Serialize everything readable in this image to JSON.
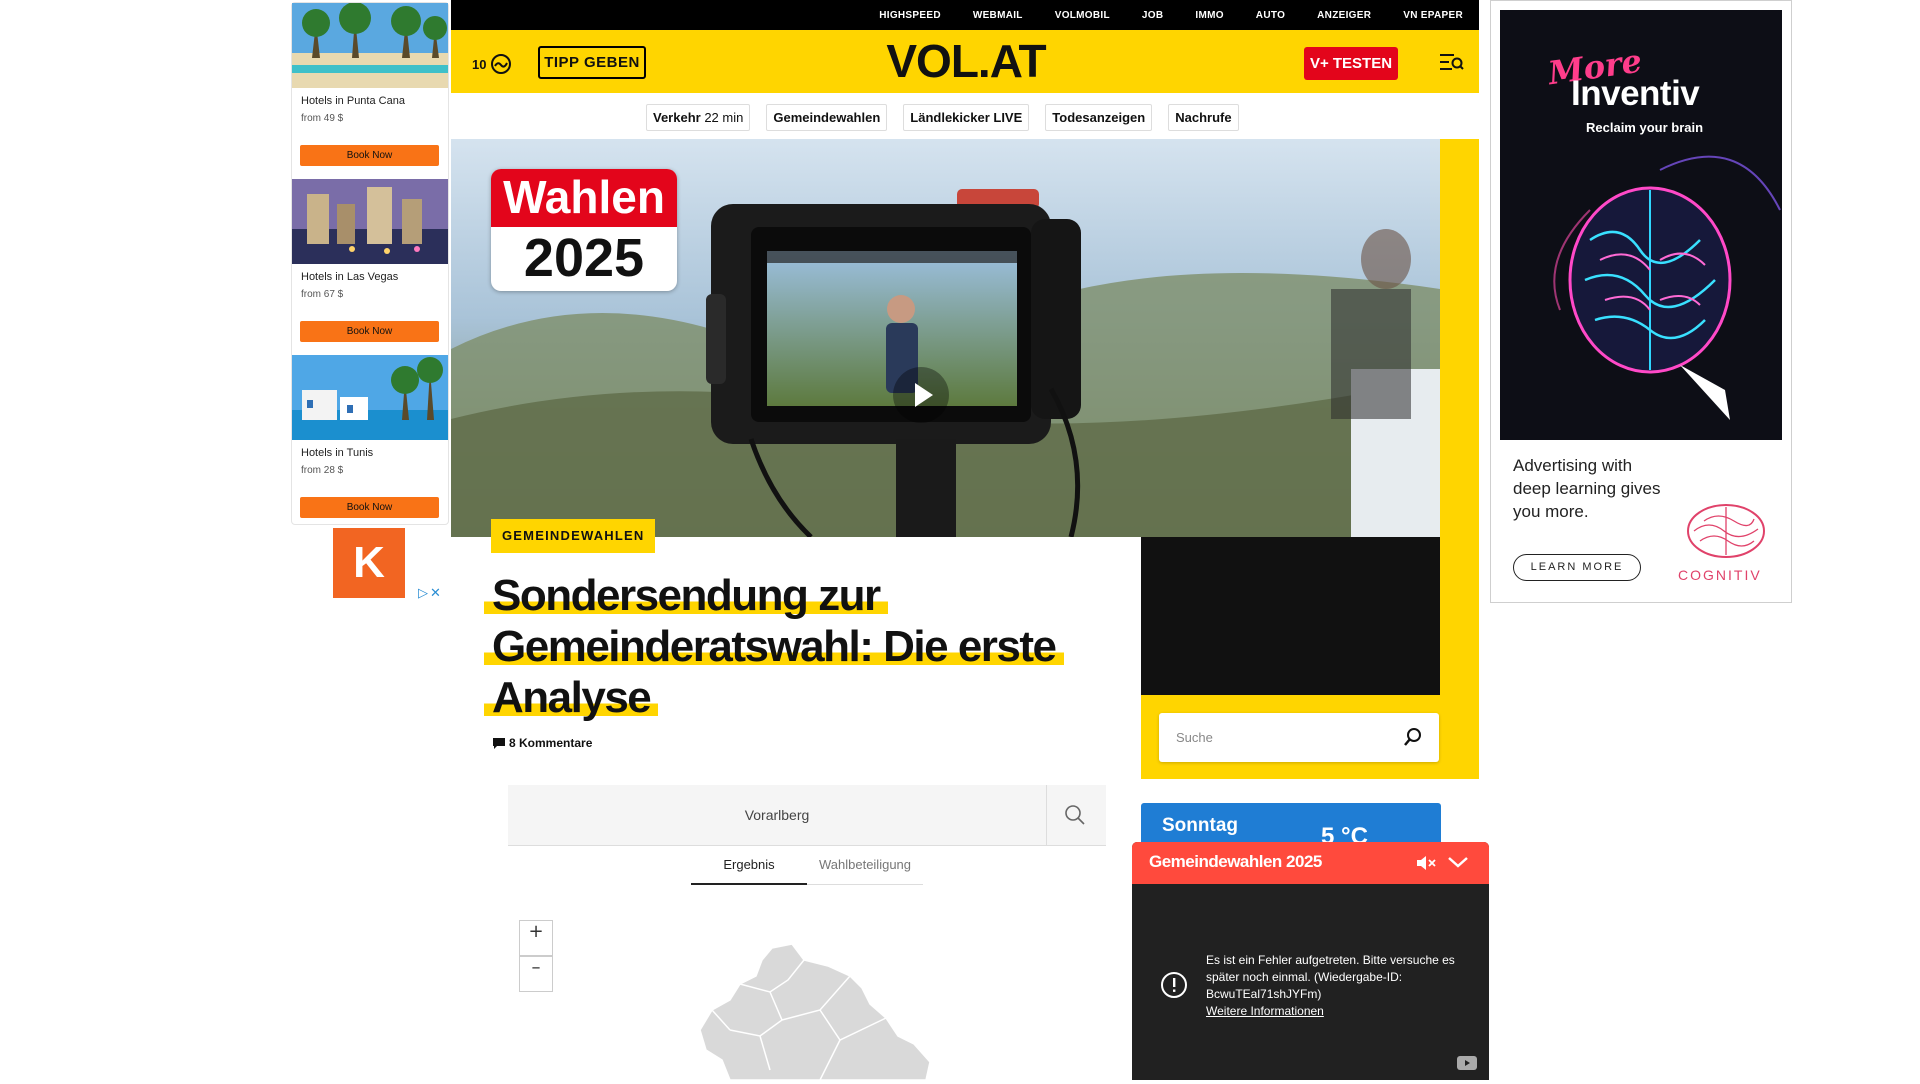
{
  "left_ad": {
    "hotels": [
      {
        "name": "Hotels in Punta Cana",
        "price": "from 49 $",
        "cta": "Book Now"
      },
      {
        "name": "Hotels in Las Vegas",
        "price": "from 67 $",
        "cta": "Book Now"
      },
      {
        "name": "Hotels in Tunis",
        "price": "from 28 $",
        "cta": "Book Now"
      }
    ],
    "k_logo": "K"
  },
  "header": {
    "top_links": [
      "HIGHSPEED",
      "WEBMAIL",
      "VOLMOBIL",
      "JOB",
      "IMMO",
      "AUTO",
      "ANZEIGER",
      "VN EPAPER"
    ],
    "temperature": "10",
    "tipp_label": "TIPP GEBEN",
    "logo": "VOL.AT",
    "vplus_label": "V+ TESTEN"
  },
  "quicknav": {
    "verkehr_label": "Verkehr",
    "verkehr_value": "22 min",
    "items": [
      "Gemeindewahlen",
      "Ländlekicker LIVE",
      "Todesanzeigen",
      "Nachrufe"
    ]
  },
  "hero": {
    "badge_line1": "Wahlen",
    "badge_line2": "2025"
  },
  "article": {
    "tag": "GEMEINDEWAHLEN",
    "headline_lines": [
      "Sondersendung zur",
      "Gemeinderatswahl: Die erste",
      "Analyse"
    ],
    "comments": "8 Kommentare"
  },
  "sidebar": {
    "search_placeholder": "Suche",
    "weather_day": "Sonntag",
    "weather_temp": "5 °C"
  },
  "election": {
    "region": "Vorarlberg",
    "tabs": [
      "Ergebnis",
      "Wahlbeteiligung"
    ],
    "zoom_in": "+",
    "zoom_out": "–"
  },
  "popup": {
    "title": "Gemeindewahlen 2025",
    "error_text": "Es ist ein Fehler aufgetreten. Bitte versuche es später noch einmal. (Wiedergabe-ID: BcwuTEal71shJYFm)",
    "error_link": "Weitere Informationen"
  },
  "right_ad": {
    "more": "More",
    "headline": "Inventiv",
    "subline": "Reclaim your brain",
    "copy": "Advertising with deep learning gives you more.",
    "cta": "LEARN MORE",
    "brand": "COGNITIV"
  },
  "colors": {
    "brand_yellow": "#ffd500",
    "vplus_red": "#e3051b",
    "popup_red": "#ff4a3d",
    "book_orange": "#f97316",
    "weather_blue": "#1f7dd4"
  }
}
